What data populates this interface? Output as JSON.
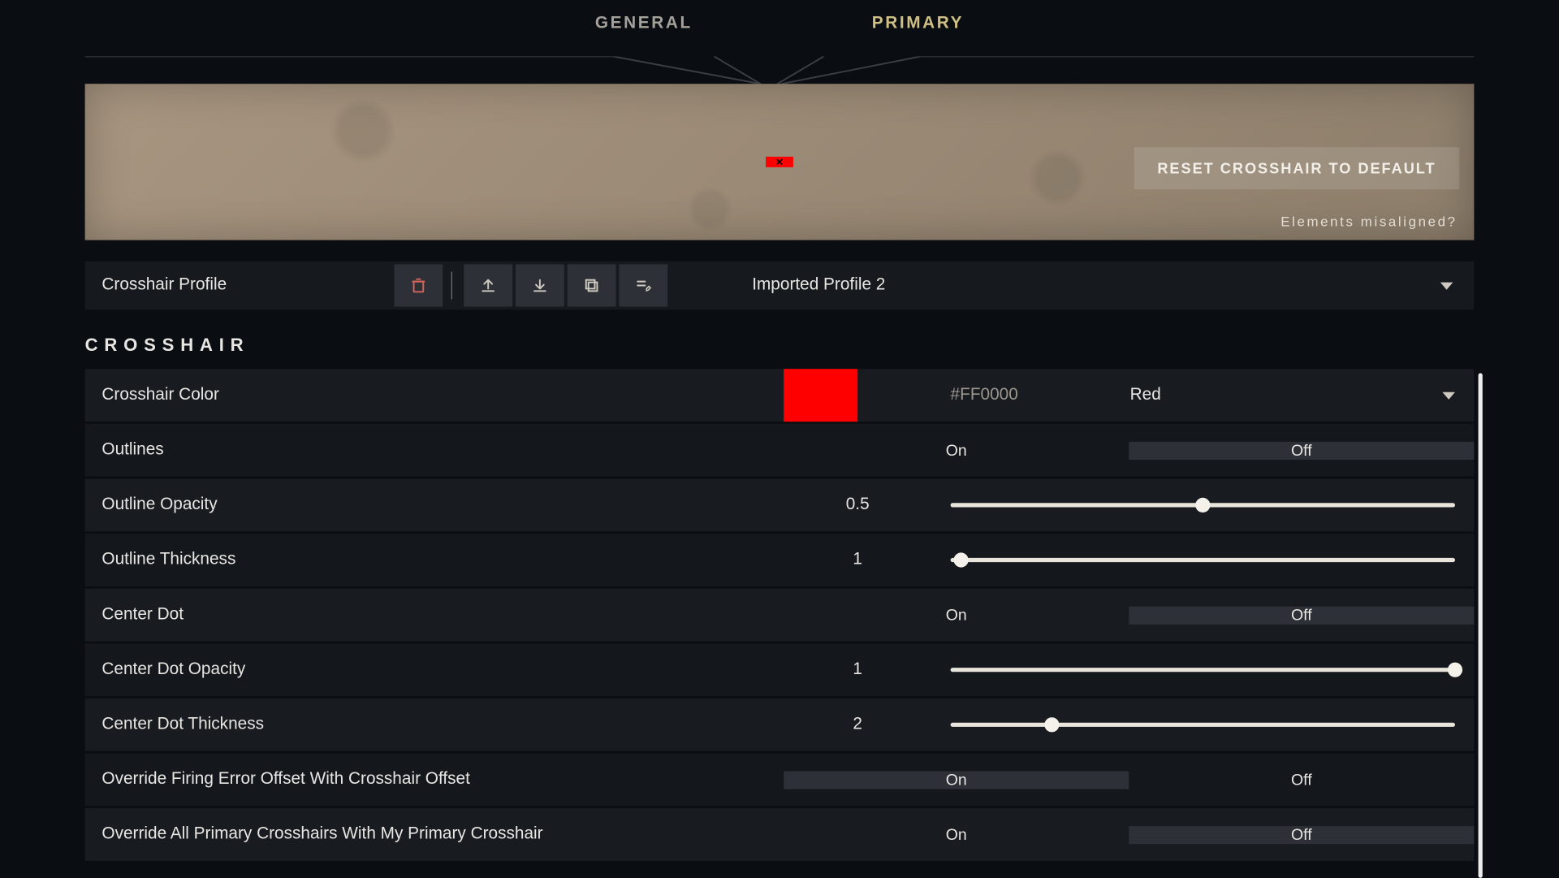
{
  "tabs": {
    "general": "GENERAL",
    "primary": "PRIMARY"
  },
  "preview": {
    "reset_label": "RESET CROSSHAIR TO DEFAULT",
    "misaligned": "Elements misaligned?"
  },
  "profile": {
    "label": "Crosshair Profile",
    "selected": "Imported Profile 2"
  },
  "section": "CROSSHAIR",
  "color": {
    "label": "Crosshair Color",
    "hex": "#FF0000",
    "name": "Red",
    "swatch": "#FF0000"
  },
  "toggles": {
    "on": "On",
    "off": "Off"
  },
  "rows": {
    "outlines": {
      "label": "Outlines",
      "value": "Off"
    },
    "outline_opacity": {
      "label": "Outline Opacity",
      "value": "0.5",
      "pct": 50
    },
    "outline_thickness": {
      "label": "Outline Thickness",
      "value": "1",
      "pct": 2
    },
    "center_dot": {
      "label": "Center Dot",
      "value": "Off"
    },
    "center_dot_opacity": {
      "label": "Center Dot Opacity",
      "value": "1",
      "pct": 100
    },
    "center_dot_thickness": {
      "label": "Center Dot Thickness",
      "value": "2",
      "pct": 20
    },
    "override_firing": {
      "label": "Override Firing Error Offset With Crosshair Offset",
      "value": "On"
    },
    "override_all": {
      "label": "Override All Primary Crosshairs With My Primary Crosshair",
      "value": "Off"
    }
  }
}
